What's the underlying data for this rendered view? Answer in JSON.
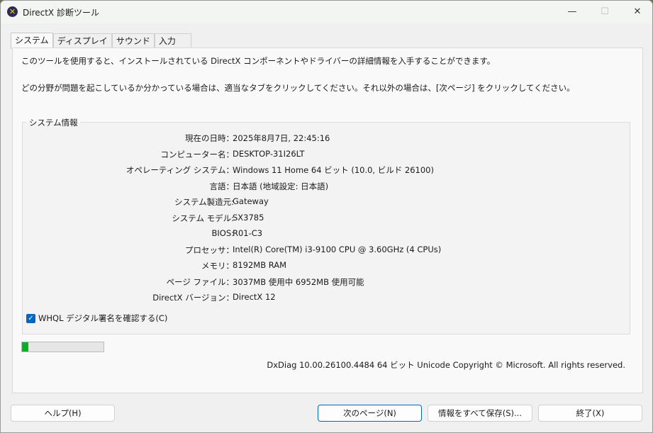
{
  "window": {
    "title": "DirectX 診断ツール",
    "minimize": "—",
    "maximize": "☐",
    "close": "✕"
  },
  "tabs": [
    {
      "label": "システム"
    },
    {
      "label": "ディスプレイ"
    },
    {
      "label": "サウンド"
    },
    {
      "label": "入力"
    }
  ],
  "intro": [
    "このツールを使用すると、インストールされている DirectX コンポーネントやドライバーの詳細情報を入手することができます。",
    "どの分野が問題を起こしているか分かっている場合は、適当なタブをクリックしてください。それ以外の場合は、[次ページ] をクリックしてください。"
  ],
  "system_info": {
    "title": "システム情報",
    "rows": [
      {
        "label": "現在の日時：",
        "value": "2025年8月7日, 22:45:16"
      },
      {
        "label": "コンピューター名：",
        "value": "DESKTOP-31I26LT"
      },
      {
        "label": "オペレーティング システム：",
        "value": "Windows 11 Home 64 ビット (10.0, ビルド 26100)"
      },
      {
        "label": "言語：",
        "value": "日本語 (地域設定: 日本語)"
      },
      {
        "label": "システム製造元:",
        "value": "Gateway"
      },
      {
        "label": "システム モデル:",
        "value": "SX3785"
      },
      {
        "label": "BIOS:",
        "value": "R01-C3"
      },
      {
        "label": "プロセッサ：",
        "value": "Intel(R) Core(TM) i3-9100 CPU @ 3.60GHz (4 CPUs)"
      },
      {
        "label": "メモリ：",
        "value": "8192MB RAM"
      },
      {
        "label": "ページ ファイル：",
        "value": "3037MB 使用中 6952MB 使用可能"
      },
      {
        "label": "DirectX バージョン：",
        "value": "DirectX 12"
      }
    ],
    "whql_label": "WHQL デジタル署名を確認する(C)",
    "whql_checked": true
  },
  "progress_percent": 8,
  "copyright": "DxDiag 10.00.26100.4484 64 ビット Unicode  Copyright © Microsoft. All rights reserved.",
  "buttons": {
    "help": "ヘルプ(H)",
    "next": "次のページ(N)",
    "save": "情報をすべて保存(S)...",
    "exit": "終了(X)"
  }
}
